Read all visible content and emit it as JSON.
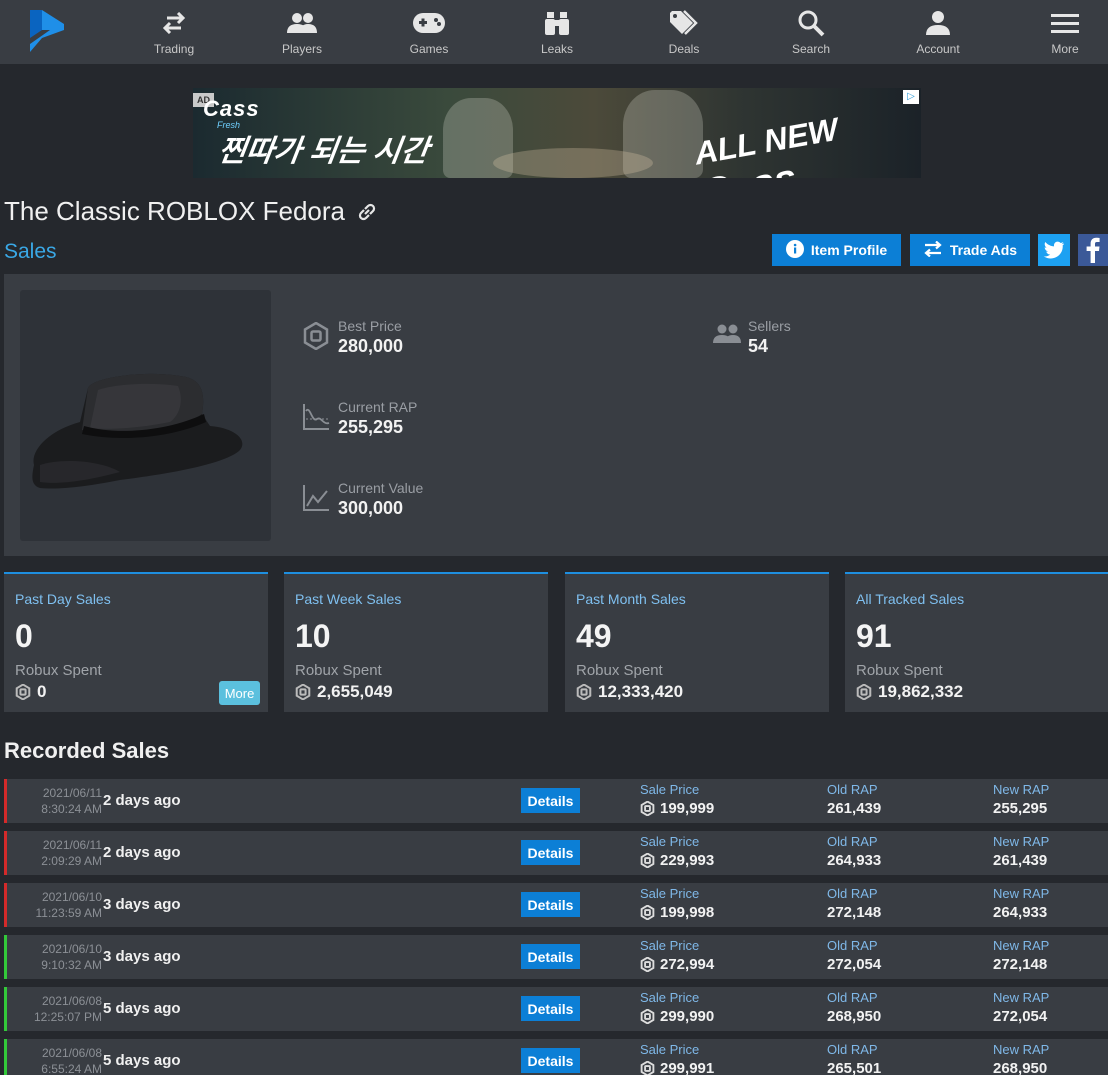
{
  "nav": {
    "items": [
      {
        "label": "Trading",
        "icon": "arrows-swap-icon"
      },
      {
        "label": "Players",
        "icon": "users-icon"
      },
      {
        "label": "Games",
        "icon": "gamepad-icon"
      },
      {
        "label": "Leaks",
        "icon": "binoculars-icon"
      },
      {
        "label": "Deals",
        "icon": "tags-icon"
      },
      {
        "label": "Search",
        "icon": "search-icon"
      },
      {
        "label": "Account",
        "icon": "user-icon"
      },
      {
        "label": "More",
        "icon": "menu-icon"
      }
    ]
  },
  "ad": {
    "tag": "AD",
    "brand": "Cass",
    "brand_sub": "Fresh",
    "headline": "찐따가 되는 시간",
    "slogan_prefix": "ALL NEW",
    "slogan_brand": "Cass"
  },
  "item": {
    "title": "The Classic ROBLOX Fedora",
    "section": "Sales",
    "buttons": {
      "profile": "Item Profile",
      "trade_ads": "Trade Ads"
    }
  },
  "stats": {
    "best_price": {
      "label": "Best Price",
      "value": "280,000"
    },
    "current_rap": {
      "label": "Current RAP",
      "value": "255,295"
    },
    "current_value": {
      "label": "Current Value",
      "value": "300,000"
    },
    "sellers": {
      "label": "Sellers",
      "value": "54"
    }
  },
  "sales_summary": [
    {
      "title": "Past Day Sales",
      "count": "0",
      "spent_label": "Robux Spent",
      "spent": "0",
      "more": "More"
    },
    {
      "title": "Past Week Sales",
      "count": "10",
      "spent_label": "Robux Spent",
      "spent": "2,655,049"
    },
    {
      "title": "Past Month Sales",
      "count": "49",
      "spent_label": "Robux Spent",
      "spent": "12,333,420"
    },
    {
      "title": "All Tracked Sales",
      "count": "91",
      "spent_label": "Robux Spent",
      "spent": "19,862,332"
    }
  ],
  "recorded_sales": {
    "title": "Recorded Sales",
    "labels": {
      "details": "Details",
      "sale_price": "Sale Price",
      "old_rap": "Old RAP",
      "new_rap": "New RAP"
    },
    "colors": {
      "down": "#d42a2a",
      "up": "#33c93a"
    },
    "rows": [
      {
        "date": "2021/06/11",
        "time": "8:30:24 AM",
        "ago": "2 days ago",
        "price": "199,999",
        "old_rap": "261,439",
        "new_rap": "255,295",
        "trend": "down"
      },
      {
        "date": "2021/06/11",
        "time": "2:09:29 AM",
        "ago": "2 days ago",
        "price": "229,993",
        "old_rap": "264,933",
        "new_rap": "261,439",
        "trend": "down"
      },
      {
        "date": "2021/06/10",
        "time": "11:23:59 AM",
        "ago": "3 days ago",
        "price": "199,998",
        "old_rap": "272,148",
        "new_rap": "264,933",
        "trend": "down"
      },
      {
        "date": "2021/06/10",
        "time": "9:10:32 AM",
        "ago": "3 days ago",
        "price": "272,994",
        "old_rap": "272,054",
        "new_rap": "272,148",
        "trend": "up"
      },
      {
        "date": "2021/06/08",
        "time": "12:25:07 PM",
        "ago": "5 days ago",
        "price": "299,990",
        "old_rap": "268,950",
        "new_rap": "272,054",
        "trend": "up"
      },
      {
        "date": "2021/06/08",
        "time": "6:55:24 AM",
        "ago": "5 days ago",
        "price": "299,991",
        "old_rap": "265,501",
        "new_rap": "268,950",
        "trend": "up"
      }
    ]
  }
}
